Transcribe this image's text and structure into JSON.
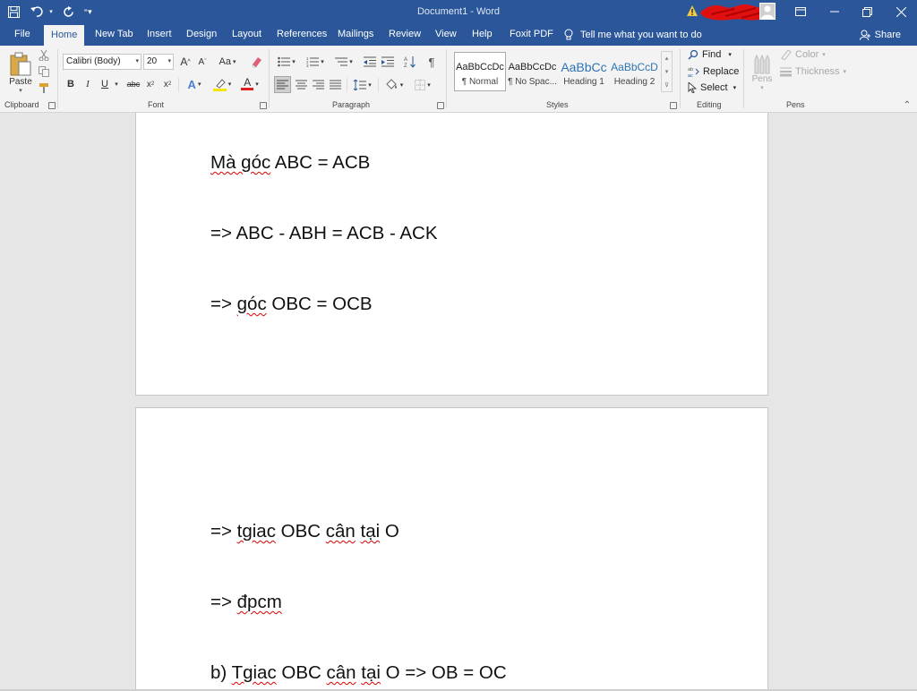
{
  "window": {
    "title": "Document1  -  Word"
  },
  "tabs": [
    {
      "label": "File"
    },
    {
      "label": "Home"
    },
    {
      "label": "New Tab"
    },
    {
      "label": "Insert"
    },
    {
      "label": "Design"
    },
    {
      "label": "Layout"
    },
    {
      "label": "References"
    },
    {
      "label": "Mailings"
    },
    {
      "label": "Review"
    },
    {
      "label": "View"
    },
    {
      "label": "Help"
    },
    {
      "label": "Foxit PDF"
    }
  ],
  "tell_me": "Tell me what you want to do",
  "share": "Share",
  "clipboard": {
    "paste": "Paste",
    "label": "Clipboard"
  },
  "font": {
    "name": "Calibri (Body)",
    "size": "20",
    "change_case": "Aa",
    "label": "Font"
  },
  "paragraph": {
    "label": "Paragraph"
  },
  "styles": {
    "label": "Styles",
    "items": [
      {
        "preview": "AaBbCcDc",
        "name": "¶ Normal",
        "color": "#222222"
      },
      {
        "preview": "AaBbCcDc",
        "name": "¶ No Spac...",
        "color": "#222222"
      },
      {
        "preview": "AaBbCc",
        "name": "Heading 1",
        "color": "#2e74b5"
      },
      {
        "preview": "AaBbCcD",
        "name": "Heading 2",
        "color": "#2e74b5"
      }
    ]
  },
  "editing": {
    "find": "Find",
    "replace": "Replace",
    "select": "Select",
    "label": "Editing"
  },
  "pens": {
    "pens": "Pens",
    "color": "Color",
    "thickness": "Thickness",
    "label": "Pens"
  },
  "document": {
    "page1": [
      {
        "pre": "",
        "sq": "Mà góc",
        "post": " ABC = ACB"
      },
      {
        "pre": "=> ABC - ABH = ACB - ACK",
        "sq": "",
        "post": ""
      },
      {
        "pre": "=> ",
        "sq": "góc",
        "post": " OBC = OCB"
      }
    ],
    "page2": [
      {
        "pre": "=> ",
        "sq": "tgiac",
        "post": " OBC ",
        "sq2": "cân",
        "post2": " ",
        "sq3": "tại",
        "post3": " O"
      },
      {
        "pre": "=> ",
        "sq": "đpcm",
        "post": ""
      },
      {
        "pre": "b) ",
        "sq": "Tgiac",
        "post": " OBC ",
        "sq2": "cân",
        "post2": " ",
        "sq3": "tại",
        "post3": " O => OB = OC"
      }
    ]
  }
}
